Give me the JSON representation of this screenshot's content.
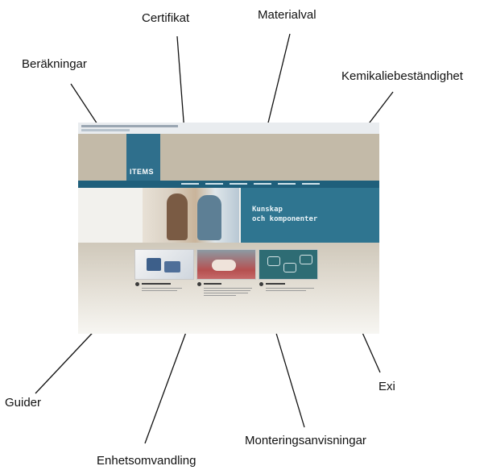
{
  "callouts": [
    {
      "id": "berakningar",
      "text": "Beräkningar"
    },
    {
      "id": "certifikat",
      "text": "Certifikat"
    },
    {
      "id": "materialval",
      "text": "Materialval"
    },
    {
      "id": "kemikalie",
      "text": "Kemikaliebeständighet"
    },
    {
      "id": "guider",
      "text": "Guider"
    },
    {
      "id": "enhetsomvandling",
      "text": "Enhetsomvandling"
    },
    {
      "id": "monteringsanvisningar",
      "text": "Monteringsanvisningar"
    },
    {
      "id": "exi",
      "text": "Exi"
    }
  ],
  "screenshot": {
    "logo": "ITEMS",
    "hero_line_1": "Kunskap",
    "hero_line_2": "och komponenter"
  },
  "colors": {
    "header_bg": "#c3baa8",
    "logo_bg": "#2f6f8c",
    "nav_bg": "#1f5f7b",
    "hero_panel": "#2f7590"
  }
}
